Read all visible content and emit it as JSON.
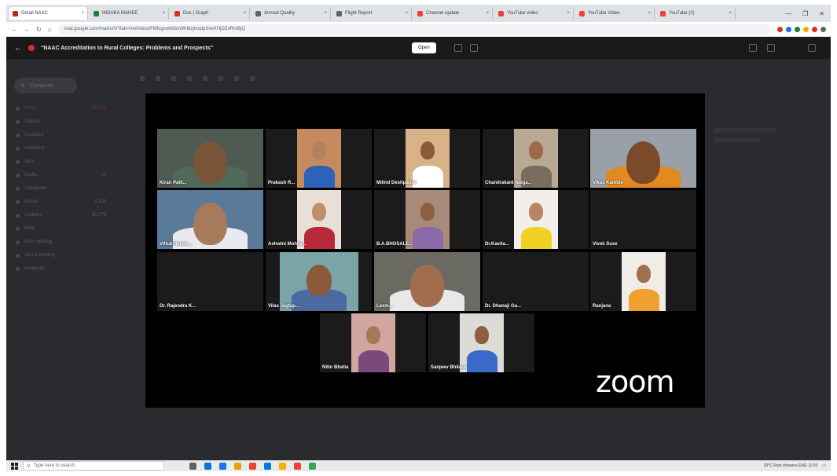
{
  "browser": {
    "tabs": [
      {
        "label": "Gmail NAAC",
        "color": "#c5221f",
        "active": true
      },
      {
        "label": "INDUKA MAHEE",
        "color": "#188038"
      },
      {
        "label": "Doc | Graph",
        "color": "#d93025"
      },
      {
        "label": "Annual Quality",
        "color": "#5f6368"
      },
      {
        "label": "Flight Report",
        "color": "#5f6368"
      },
      {
        "label": "Channel update",
        "color": "#ea4335"
      },
      {
        "label": "YouTube video",
        "color": "#ea4335"
      },
      {
        "label": "YouTube Video",
        "color": "#ea4335"
      },
      {
        "label": "YouTube (2)",
        "color": "#ea4335"
      }
    ],
    "url": "mail.google.com/mail/u/0/?tab=rm#inbox/FMfcgxwKkbxWhMzjmsdpSrwXHjDZnRmBjQ",
    "window_controls": [
      "—",
      "❐",
      "✕"
    ],
    "extension_colors": [
      "#d93025",
      "#1a73e8",
      "#188038",
      "#f9ab00",
      "#d93025",
      "#5f6368"
    ]
  },
  "player": {
    "title": "\"NAAC Accreditation to Rural Colleges: Problems and Prospects\"",
    "open_with": "Open"
  },
  "gmail": {
    "compose": "Compose",
    "rows": [
      {
        "label": "Inbox",
        "count": "35,783",
        "selected": true
      },
      {
        "label": "Starred",
        "count": ""
      },
      {
        "label": "Snoozed",
        "count": ""
      },
      {
        "label": "Important",
        "count": ""
      },
      {
        "label": "Sent",
        "count": ""
      },
      {
        "label": "Drafts",
        "count": "14"
      },
      {
        "label": "Categories",
        "count": ""
      },
      {
        "label": "Social",
        "count": "2,108"
      },
      {
        "label": "Updates",
        "count": "56,779"
      },
      {
        "label": "Meet",
        "count": ""
      },
      {
        "label": "New meeting",
        "count": ""
      },
      {
        "label": "Join a meeting",
        "count": ""
      },
      {
        "label": "Hangouts",
        "count": ""
      }
    ]
  },
  "zoom": {
    "logo": "zoom",
    "active_speaker_color": "#7ecb20",
    "participants": [
      {
        "name": "Kiran Patil...",
        "photo": true,
        "skin": "#7a5438",
        "shirt": "#4d6a5a",
        "bg": "#4e5a52",
        "w": 135
      },
      {
        "name": "Prakash R...",
        "photo": true,
        "skin": "#b5805c",
        "shirt": "#2c63b8",
        "bg": "#c58a5e",
        "w": 56
      },
      {
        "name": "Milind Deshpande",
        "photo": true,
        "skin": "#8a5a3a",
        "shirt": "#ffffff",
        "bg": "#d9b28a",
        "w": 56
      },
      {
        "name": "Chandrakant Naiga...",
        "photo": true,
        "skin": "#9a6a4a",
        "shirt": "#7a6d60",
        "bg": "#b9a894",
        "w": 56
      },
      {
        "name": "Vikas Kamble",
        "photo": true,
        "skin": "#7a4a2a",
        "shirt": "#e08a20",
        "bg": "#9aa0a8",
        "w": 135,
        "active": true
      },
      {
        "name": "Vithal Hande...",
        "photo": true,
        "skin": "#a67a5a",
        "shirt": "#e8e8ee",
        "bg": "#5a7a9a",
        "w": 135
      },
      {
        "name": "Ashwini Mohite...",
        "photo": true,
        "skin": "#c08e6a",
        "shirt": "#b82a3a",
        "bg": "#e8e0d8",
        "w": 56
      },
      {
        "name": "B.A.BHOSALE...",
        "photo": true,
        "skin": "#8a6040",
        "shirt": "#8a6aa8",
        "bg": "#a88a7a",
        "w": 56
      },
      {
        "name": "Dr.Kavita...",
        "photo": true,
        "skin": "#b68464",
        "shirt": "#f0d020",
        "bg": "#f2eeea",
        "w": 56
      },
      {
        "name": "Vivek Suse",
        "photo": false
      },
      {
        "name": "Dr. Rajendra K...",
        "photo": false
      },
      {
        "name": "Vilas Jagtap...",
        "photo": true,
        "skin": "#8a5a3a",
        "shirt": "#4a6aa0",
        "bg": "#7aa4a8",
        "w": 100
      },
      {
        "name": "Laxm...",
        "photo": true,
        "skin": "#a06e4e",
        "shirt": "#e8e8e8",
        "bg": "#6a6a62",
        "w": 135
      },
      {
        "name": "Dr. Dhanaji Ga...",
        "photo": false
      },
      {
        "name": "Ranjana",
        "photo": true,
        "skin": "#a0704e",
        "shirt": "#f0a030",
        "bg": "#f0ece6",
        "w": 56
      },
      {
        "name": "Nitin Bhatia",
        "photo": true,
        "skin": "#a57a5a",
        "shirt": "#7a4a7a",
        "bg": "#d2a6a0",
        "w": 56
      },
      {
        "name": "Sanjeev Bhilare",
        "photo": true,
        "skin": "#8e5e3e",
        "shirt": "#3a6ac8",
        "bg": "#dcdcd6",
        "w": 56
      }
    ]
  },
  "taskbar": {
    "search_placeholder": "Type here to search",
    "app_colors": [
      "#5f6368",
      "#0078d4",
      "#1a73e8",
      "#e8a000",
      "#ea4335",
      "#0078d4",
      "#f4b400",
      "#ea4335",
      "#34a853"
    ],
    "tray_text": "29°C Rain showers  ENG  11:03"
  }
}
